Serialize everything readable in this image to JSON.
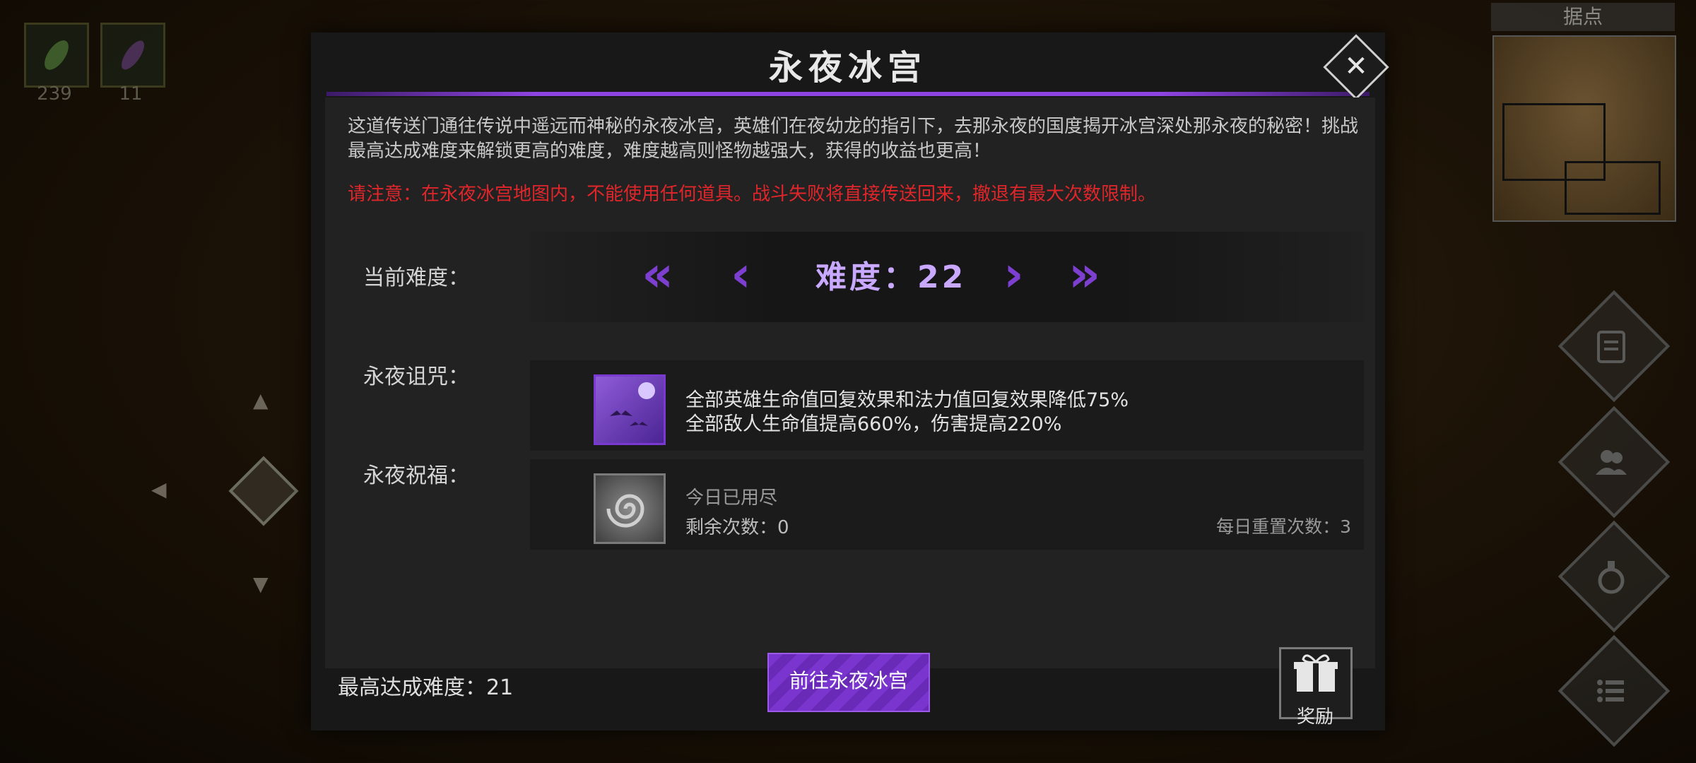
{
  "hud": {
    "resources": [
      {
        "icon": "green-leaf-icon",
        "count": "239"
      },
      {
        "icon": "purple-feather-icon",
        "count": "11"
      }
    ],
    "minimap_label": "据点"
  },
  "dialog": {
    "title": "永夜冰宫",
    "description": "这道传送门通往传说中遥远而神秘的永夜冰宫，英雄们在夜幼龙的指引下，去那永夜的国度揭开冰宫深处那永夜的秘密！挑战最高达成难度来解锁更高的难度，难度越高则怪物越强大，获得的收益也更高！",
    "warning": "请注意：在永夜冰宫地图内，不能使用任何道具。战斗失败将直接传送回来，撤退有最大次数限制。",
    "difficulty": {
      "label": "当前难度：",
      "value_text": "难度：22",
      "first": "«",
      "prev": "‹",
      "next": "›",
      "last": "»"
    },
    "curse": {
      "label": "永夜诅咒：",
      "line1": "全部英雄生命值回复效果和法力值回复效果降低75%",
      "line2": "全部敌人生命值提高660%，伤害提高220%"
    },
    "blessing": {
      "label": "永夜祝福：",
      "status": "今日已用尽",
      "remaining": "剩余次数：0",
      "daily_reset": "每日重置次数：3"
    },
    "max_difficulty": "最高达成难度：21",
    "go_button": "前往永夜冰宫",
    "reward_label": "奖励"
  },
  "colors": {
    "accent": "#7b35cf",
    "warning": "#e0262a",
    "difficulty_text": "#c9a8ff"
  }
}
